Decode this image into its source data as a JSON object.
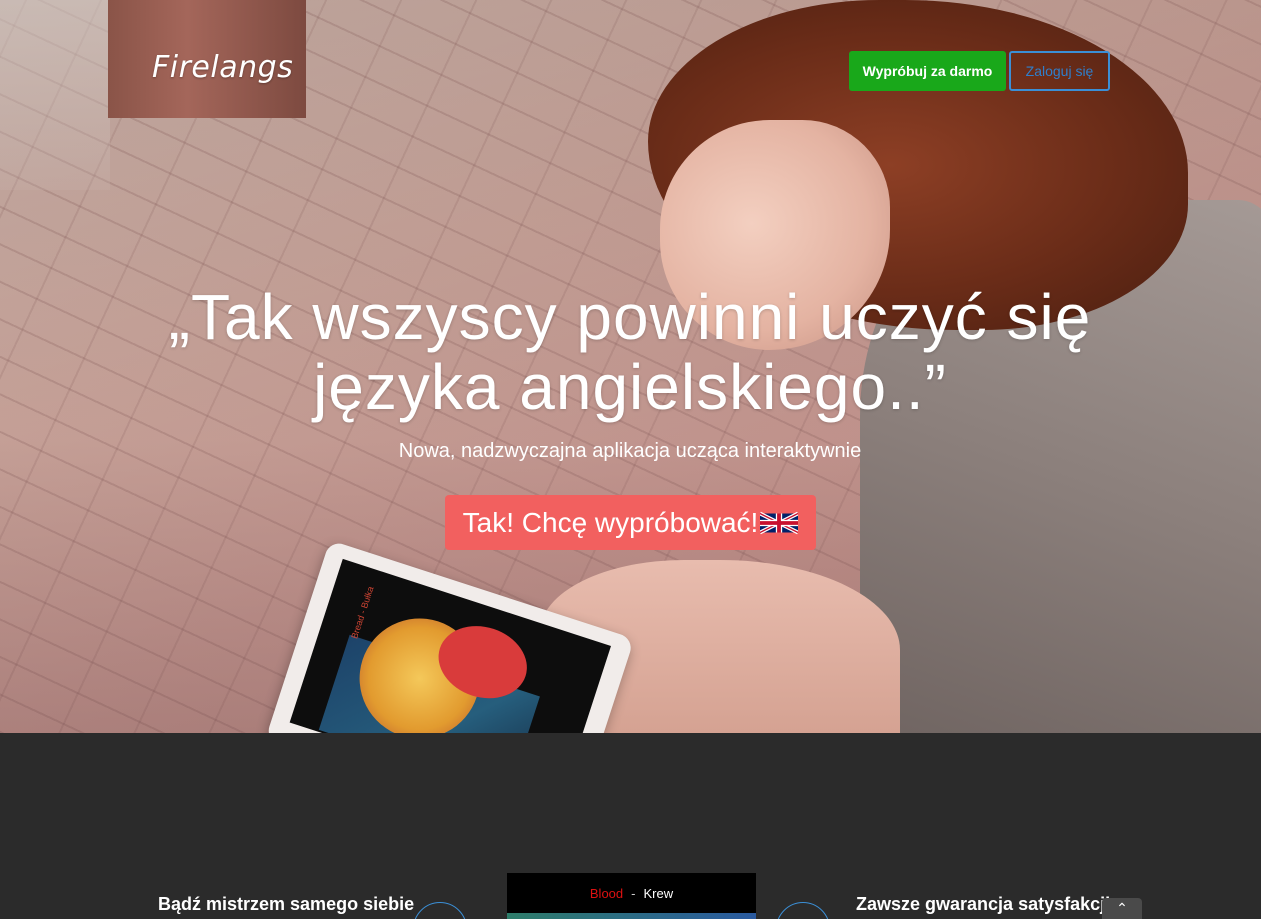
{
  "header": {
    "logo": "Firelangs",
    "try_free_label": "Wypróbuj za darmo",
    "login_label": "Zaloguj się"
  },
  "hero": {
    "headline": "„Tak wszyscy powinni uczyć się języka angielskiego..”",
    "subheadline": "Nowa, nadzwyczajna aplikacja ucząca interaktywnie",
    "cta_label": "Tak! Chcę wypróbować!",
    "tablet_label": "Bread - Bułka"
  },
  "features": {
    "left_title": "Bądź mistrzem samego siebie",
    "right_title": "Zawsze gwarancja satysfakcji"
  },
  "phone_preview": {
    "word_en": "Blood",
    "separator": "-",
    "word_pl": "Krew"
  },
  "scroll_top": {
    "icon": "chevron-up-icon",
    "glyph": "⌃"
  },
  "colors": {
    "try_button": "#19a81a",
    "login_border": "#3b8fd6",
    "cta": "#f2605f",
    "dark_section": "#2b2b2b"
  }
}
